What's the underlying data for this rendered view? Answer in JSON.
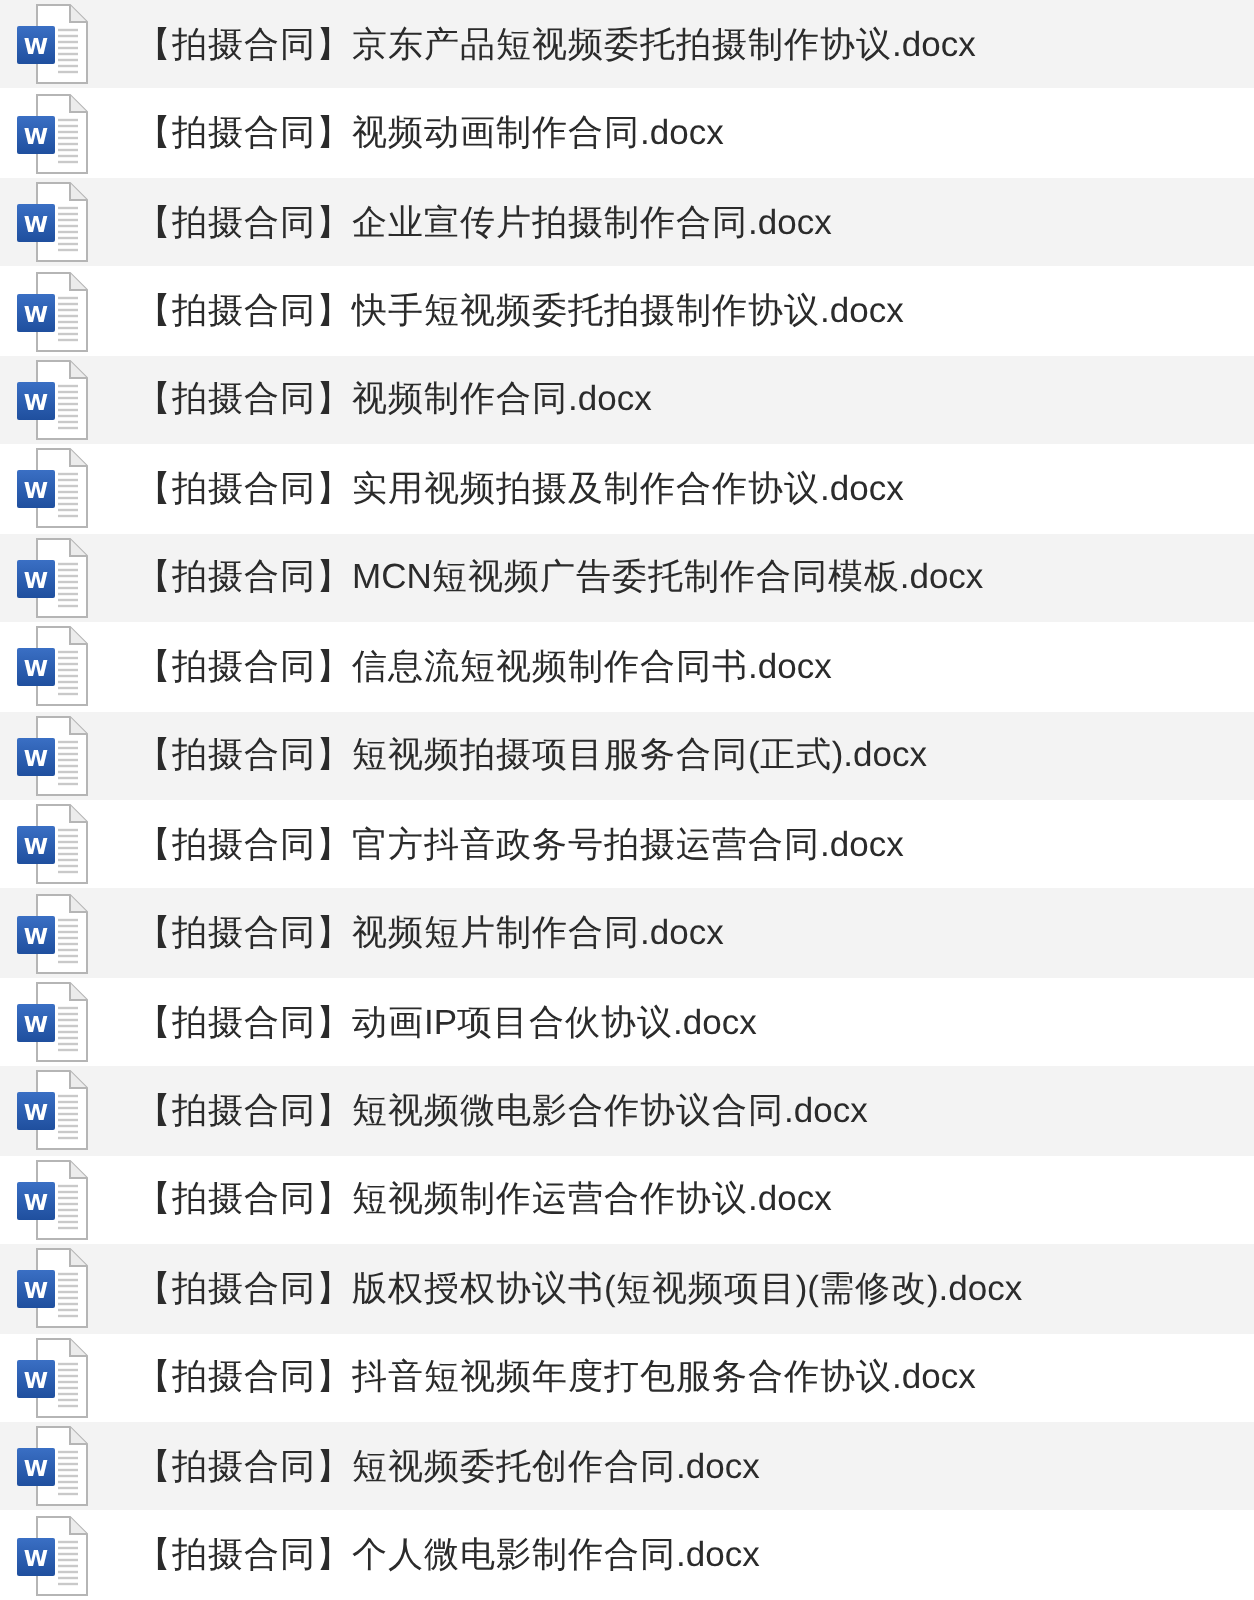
{
  "files": [
    {
      "icon_text": "W",
      "name": "【拍摄合同】京东产品短视频委托拍摄制作协议.docx"
    },
    {
      "icon_text": "W",
      "name": "【拍摄合同】视频动画制作合同.docx"
    },
    {
      "icon_text": "W",
      "name": "【拍摄合同】企业宣传片拍摄制作合同.docx"
    },
    {
      "icon_text": "W",
      "name": "【拍摄合同】快手短视频委托拍摄制作协议.docx"
    },
    {
      "icon_text": "W",
      "name": "【拍摄合同】视频制作合同.docx"
    },
    {
      "icon_text": "W",
      "name": "【拍摄合同】实用视频拍摄及制作合作协议.docx"
    },
    {
      "icon_text": "W",
      "name": "【拍摄合同】MCN短视频广告委托制作合同模板.docx"
    },
    {
      "icon_text": "W",
      "name": "【拍摄合同】信息流短视频制作合同书.docx"
    },
    {
      "icon_text": "W",
      "name": "【拍摄合同】短视频拍摄项目服务合同(正式).docx"
    },
    {
      "icon_text": "W",
      "name": "【拍摄合同】官方抖音政务号拍摄运营合同.docx"
    },
    {
      "icon_text": "W",
      "name": "【拍摄合同】视频短片制作合同.docx"
    },
    {
      "icon_text": "W",
      "name": "【拍摄合同】动画IP项目合伙协议.docx"
    },
    {
      "icon_text": "W",
      "name": "【拍摄合同】短视频微电影合作协议合同.docx"
    },
    {
      "icon_text": "W",
      "name": "【拍摄合同】短视频制作运营合作协议.docx"
    },
    {
      "icon_text": "W",
      "name": "【拍摄合同】版权授权协议书(短视频项目)(需修改).docx"
    },
    {
      "icon_text": "W",
      "name": "【拍摄合同】抖音短视频年度打包服务合作协议.docx"
    },
    {
      "icon_text": "W",
      "name": "【拍摄合同】短视频委托创作合同.docx"
    },
    {
      "icon_text": "W",
      "name": "【拍摄合同】个人微电影制作合同.docx"
    }
  ]
}
